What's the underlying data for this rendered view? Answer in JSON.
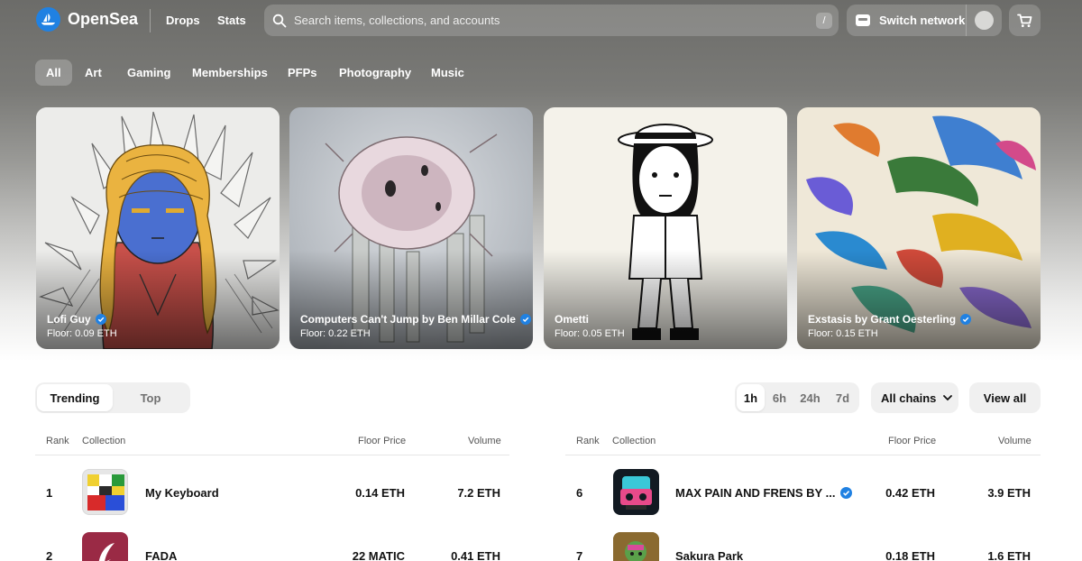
{
  "header": {
    "brand": "OpenSea",
    "nav": [
      "Drops",
      "Stats"
    ],
    "search_placeholder": "Search items, collections, and accounts",
    "search_shortcut": "/",
    "switch_network": "Switch network"
  },
  "categories": [
    "All",
    "Art",
    "Gaming",
    "Memberships",
    "PFPs",
    "Photography",
    "Music"
  ],
  "active_category": "All",
  "featured": [
    {
      "name": "Lofi Guy",
      "floor": "Floor: 0.09 ETH",
      "verified": true
    },
    {
      "name": "Computers Can't Jump by Ben Millar Cole",
      "floor": "Floor: 0.22 ETH",
      "verified": true
    },
    {
      "name": "Ometti",
      "floor": "Floor: 0.05 ETH",
      "verified": false
    },
    {
      "name": "Exstasis by Grant Oesterling",
      "floor": "Floor: 0.15 ETH",
      "verified": true
    }
  ],
  "ranking_tabs": [
    "Trending",
    "Top"
  ],
  "active_ranking_tab": "Trending",
  "time_ranges": [
    "1h",
    "6h",
    "24h",
    "7d"
  ],
  "active_time_range": "1h",
  "chains_label": "All chains",
  "view_all": "View all",
  "table_headers": {
    "rank": "Rank",
    "collection": "Collection",
    "floor": "Floor Price",
    "volume": "Volume"
  },
  "rows_left": [
    {
      "rank": "1",
      "name": "My Keyboard",
      "floor": "0.14 ETH",
      "volume": "7.2 ETH",
      "verified": false
    },
    {
      "rank": "2",
      "name": "FADA",
      "floor": "22 MATIC",
      "volume": "0.41 ETH",
      "verified": false
    }
  ],
  "rows_right": [
    {
      "rank": "6",
      "name": "MAX PAIN AND FRENS BY ...",
      "floor": "0.42 ETH",
      "volume": "3.9 ETH",
      "verified": true
    },
    {
      "rank": "7",
      "name": "Sakura Park",
      "floor": "0.18 ETH",
      "volume": "1.6 ETH",
      "verified": false
    }
  ],
  "colors": {
    "brand": "#2081e2",
    "verified": "#2081e2"
  }
}
